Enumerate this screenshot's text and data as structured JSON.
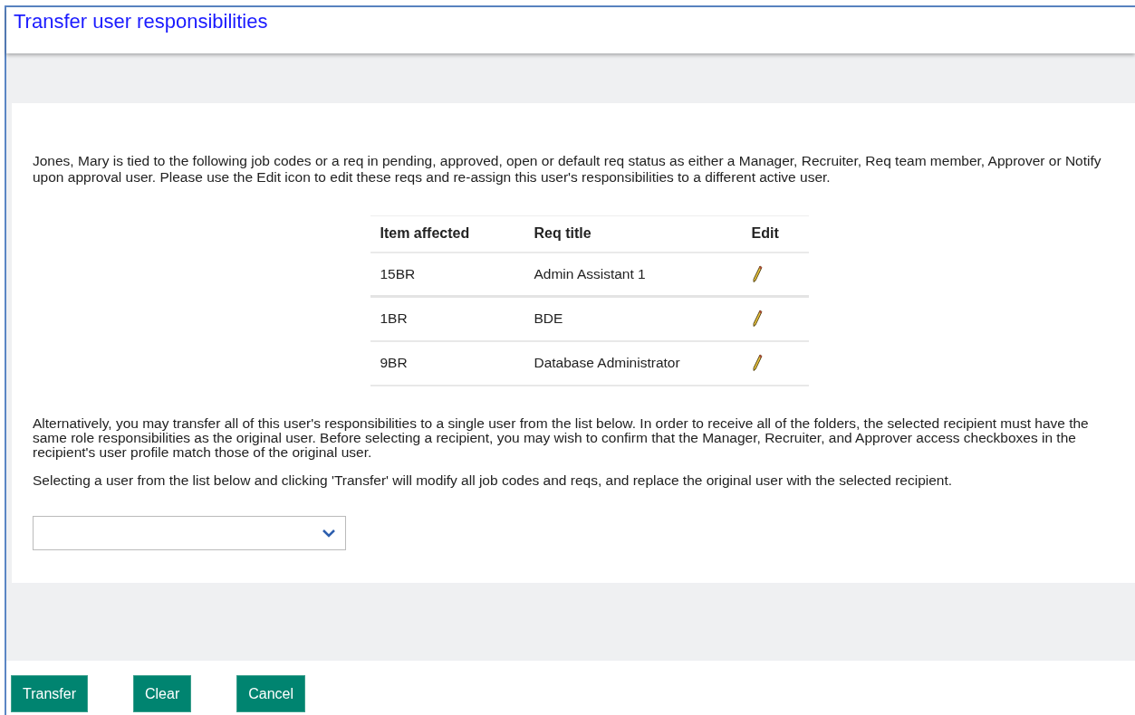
{
  "window": {
    "title": "Transfer user responsibilities"
  },
  "intro": "Jones, Mary is tied to the following job codes or a req in pending, approved, open or default req status as either a Manager, Recruiter, Req team member, Approver or Notify upon approval user. Please use the Edit icon to edit these reqs and re-assign this user's responsibilities to a different active user.",
  "table": {
    "columns": [
      "Item affected",
      "Req title",
      "Edit"
    ],
    "rows": [
      {
        "item": "15BR",
        "title": "Admin Assistant 1"
      },
      {
        "item": "1BR",
        "title": "BDE"
      },
      {
        "item": "9BR",
        "title": "Database Administrator"
      }
    ]
  },
  "alternative": "Alternatively, you may transfer all of this user's responsibilities to a single user from the list below. In order to receive all of the folders, the selected recipient must have the same role responsibilities as the original user. Before selecting a recipient, you may wish to confirm that the Manager, Recruiter, and Approver access checkboxes in the recipient's user profile match those of the original user.",
  "instruction": "Selecting a user from the list below and clicking 'Transfer' will modify all job codes and reqs, and replace the original user with the selected recipient.",
  "buttons": [
    "Transfer",
    "Clear",
    "Cancel"
  ]
}
